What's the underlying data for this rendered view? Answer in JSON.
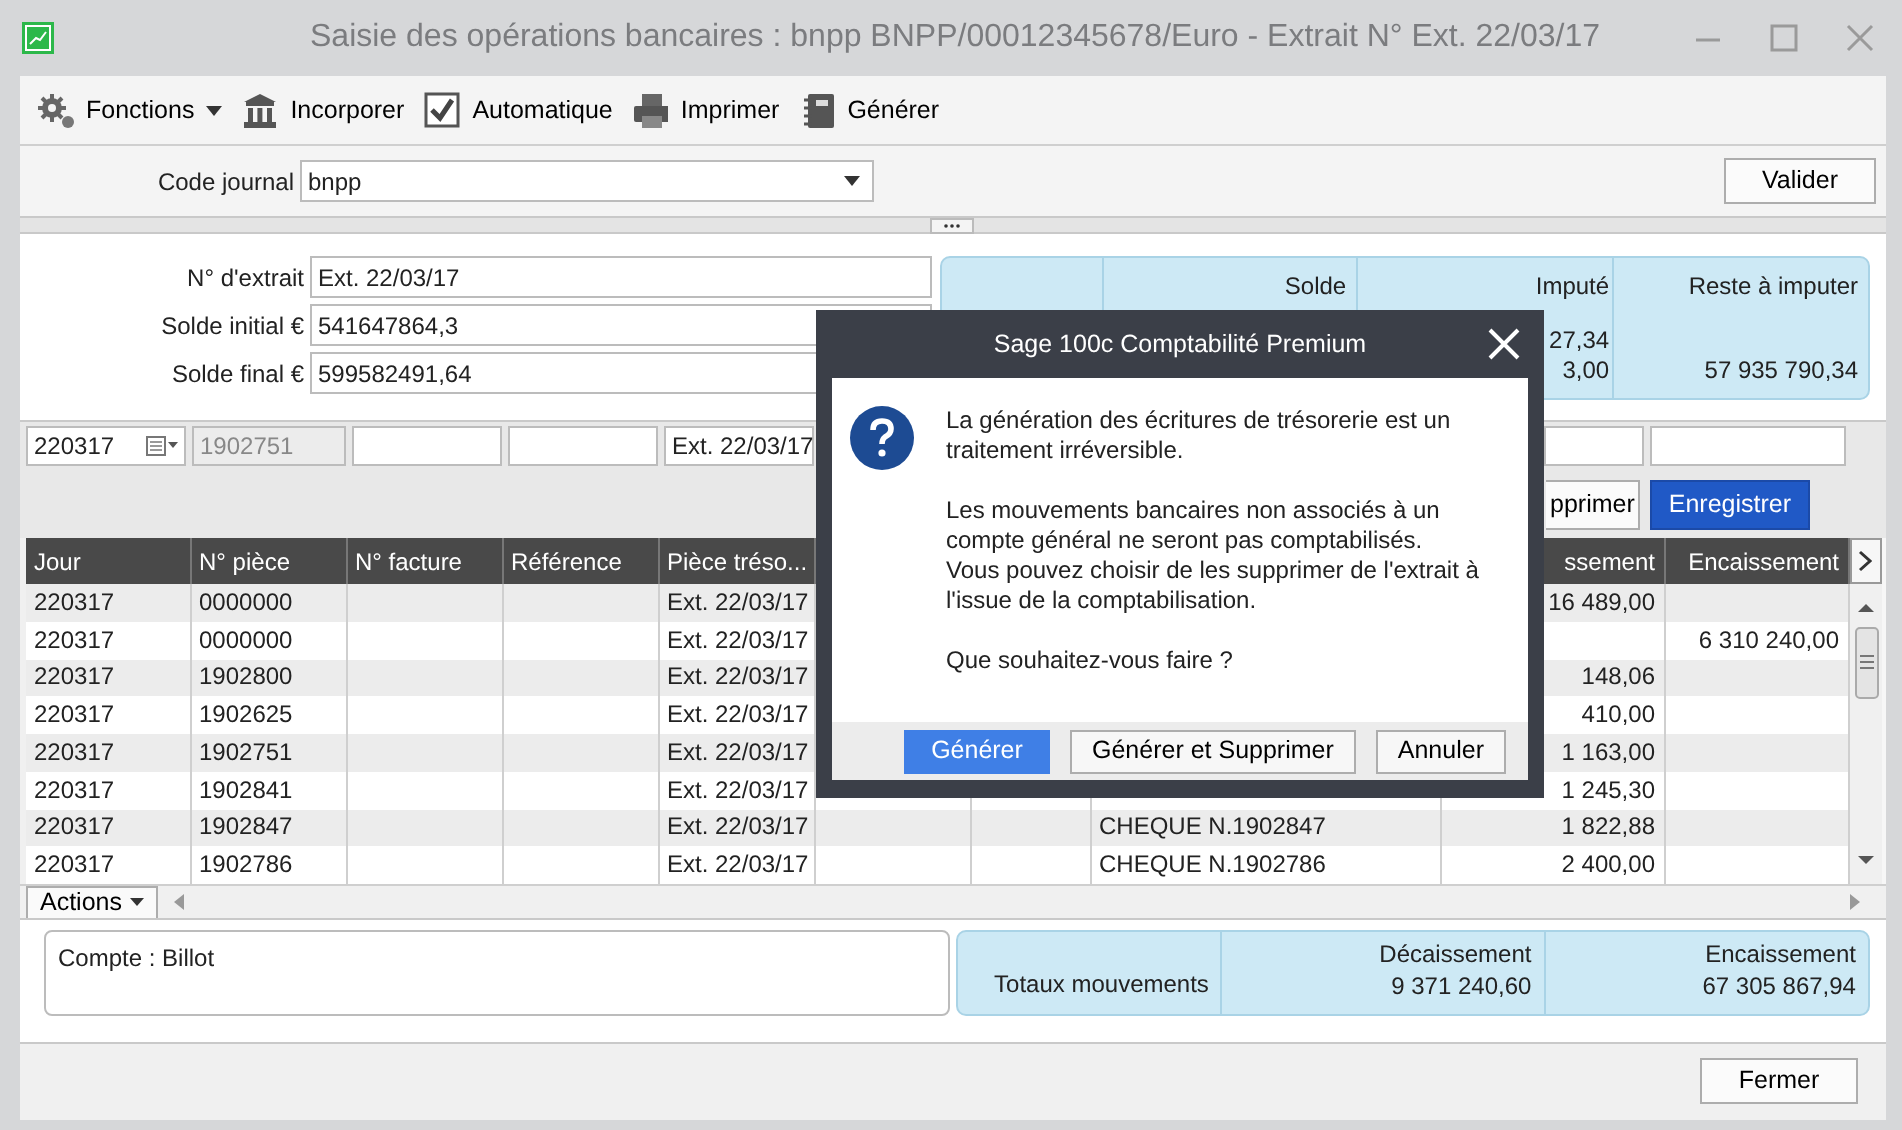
{
  "window": {
    "title": "Saisie des opérations bancaires : bnpp BNPP/00012345678/Euro - Extrait N° Ext. 22/03/17"
  },
  "toolbar": [
    {
      "label": "Fonctions",
      "kind": "menu"
    },
    {
      "label": "Incorporer",
      "kind": "bank"
    },
    {
      "label": "Automatique",
      "kind": "check",
      "checked": true
    },
    {
      "label": "Imprimer",
      "kind": "print"
    },
    {
      "label": "Générer",
      "kind": "book"
    }
  ],
  "journal": {
    "label": "Code journal",
    "value": "bnpp",
    "button": "Valider"
  },
  "statement_fields": [
    {
      "label": "N° d'extrait",
      "value": "Ext. 22/03/17"
    },
    {
      "label": "Solde initial €",
      "value": "541647864,3"
    },
    {
      "label": "Solde final €",
      "value": "599582491,64"
    }
  ],
  "summary": {
    "columns": [
      {
        "heading": "Solde"
      },
      {
        "heading": "Imputé",
        "values": [
          "27,34",
          "3,00"
        ]
      },
      {
        "heading": "Reste à imputer",
        "values": [
          "57 935 790,34"
        ]
      }
    ]
  },
  "entry_fields": [
    {
      "kind": "date",
      "value": "220317",
      "disabled": false
    },
    {
      "kind": "text",
      "value": "1902751",
      "disabled": true
    },
    {
      "kind": "text",
      "disabled": false
    },
    {
      "kind": "text",
      "disabled": false
    },
    {
      "kind": "text",
      "value": "Ext. 22/03/17",
      "disabled": false
    }
  ],
  "entry_fields_right": [
    {
      "disabled": false
    },
    {
      "disabled": false
    }
  ],
  "row_buttons": [
    {
      "label": "pprimer",
      "primary": false
    },
    {
      "label": "Enregistrer",
      "primary": true
    }
  ],
  "table": {
    "columns": [
      "Jour",
      "N° pièce",
      "N° facture",
      "Référence",
      "Pièce tréso...",
      null,
      null,
      null,
      "ssement",
      "Encaissement"
    ],
    "rows": [
      [
        "220317",
        "0000000",
        null,
        null,
        "Ext. 22/03/17",
        null,
        null,
        null,
        "16 489,00",
        null
      ],
      [
        "220317",
        "0000000",
        null,
        null,
        "Ext. 22/03/17",
        null,
        null,
        null,
        null,
        "6 310 240,00"
      ],
      [
        "220317",
        "1902800",
        null,
        null,
        "Ext. 22/03/17",
        null,
        null,
        null,
        "148,06",
        null
      ],
      [
        "220317",
        "1902625",
        null,
        null,
        "Ext. 22/03/17",
        null,
        null,
        null,
        "410,00",
        null
      ],
      [
        "220317",
        "1902751",
        null,
        null,
        "Ext. 22/03/17",
        null,
        null,
        null,
        "1 163,00",
        null
      ],
      [
        "220317",
        "1902841",
        null,
        null,
        "Ext. 22/03/17",
        null,
        null,
        null,
        "1 245,30",
        null
      ],
      [
        "220317",
        "1902847",
        null,
        null,
        "Ext. 22/03/17",
        null,
        null,
        "CHEQUE N.1902847",
        "1 822,88",
        null
      ],
      [
        "220317",
        "1902786",
        null,
        null,
        "Ext. 22/03/17",
        null,
        null,
        "CHEQUE N.1902786",
        "2 400,00",
        null
      ]
    ]
  },
  "actions_button": "Actions",
  "account": "Compte : Billot",
  "totals": {
    "label": "Totaux mouvements",
    "columns": [
      {
        "heading": "Décaissement",
        "value": "9 371 240,60"
      },
      {
        "heading": "Encaissement",
        "value": "67 305 867,94"
      }
    ]
  },
  "close_button": "Fermer",
  "dialog": {
    "title": "Sage 100c Comptabilité Premium",
    "paragraphs": [
      [
        "La génération des écritures de trésorerie est un traitement irréversible."
      ],
      [
        "Les mouvements bancaires non associés à un compte général ne seront pas comptabilisés.",
        "Vous pouvez choisir de les supprimer de l'extrait à l'issue de la comptabilisation."
      ],
      [
        "Que souhaitez-vous faire ?"
      ]
    ],
    "buttons": [
      {
        "label": "Générer",
        "default": true
      },
      {
        "label": "Générer et Supprimer",
        "default": false
      },
      {
        "label": "Annuler",
        "default": false
      }
    ]
  }
}
